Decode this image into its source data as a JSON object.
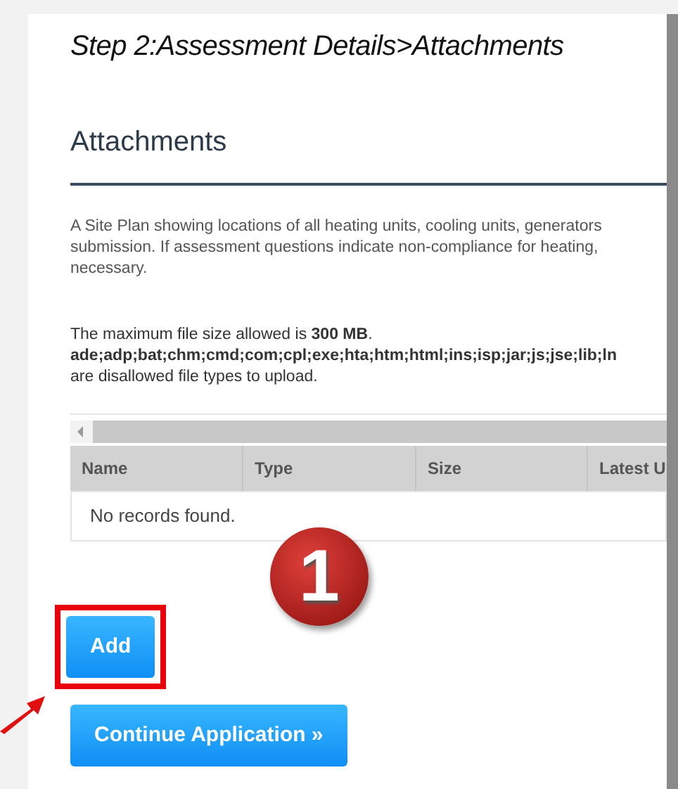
{
  "breadcrumb": "Step 2:Assessment Details>Attachments",
  "heading": "Attachments",
  "description_lines": [
    "A Site Plan showing locations of all heating units, cooling units, generators",
    "submission. If assessment questions indicate non-compliance for heating,",
    "necessary."
  ],
  "file_rules": [
    {
      "text": "The maximum file size allowed is **300 MB**.",
      "bold": false
    },
    {
      "text": "ade;adp;bat;chm;cmd;com;cpl;exe;hta;htm;html;ins;isp;jar;js;jse;lib;ln",
      "bold": true
    },
    {
      "text": "are disallowed file types to upload.",
      "bold": false
    }
  ],
  "table": {
    "columns": [
      "Name",
      "Type",
      "Size",
      "Latest U"
    ],
    "empty_message": "No records found."
  },
  "step_badge": "1",
  "buttons": [
    {
      "label": "Add",
      "highlighted": true
    },
    {
      "label": "Continue Application »",
      "highlighted": false
    }
  ]
}
